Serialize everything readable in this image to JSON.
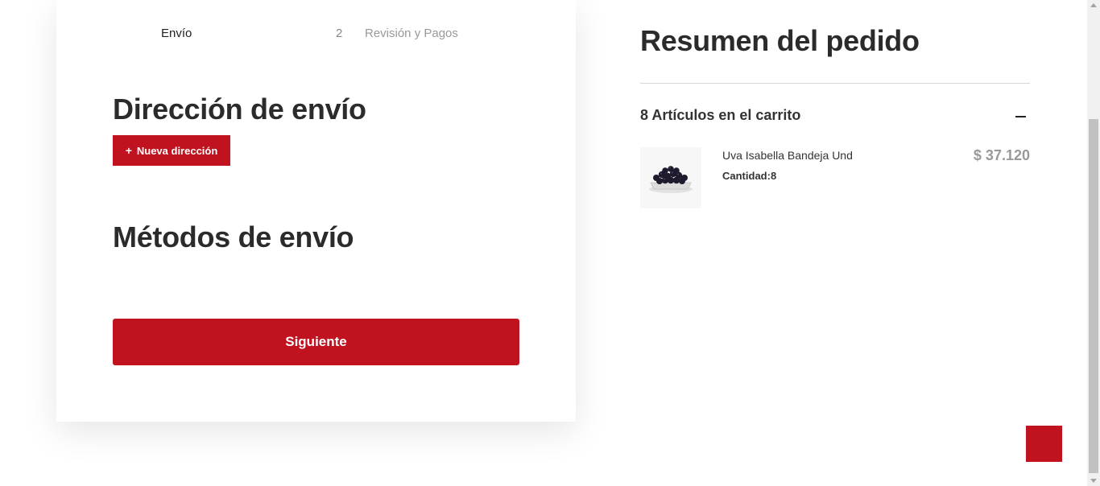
{
  "checkout": {
    "steps": [
      {
        "number": "",
        "label": "Envío",
        "active": true
      },
      {
        "number": "2",
        "label": "Revisión y Pagos",
        "active": false
      }
    ],
    "shipping_address": {
      "title": "Dirección de envío",
      "new_address_icon": "+",
      "new_address_label": "Nueva dirección"
    },
    "shipping_methods": {
      "title": "Métodos de envío"
    },
    "next_button_label": "Siguiente"
  },
  "summary": {
    "title": "Resumen del pedido",
    "cart_count_label": "8 Artículos en el carrito",
    "collapse_icon": "minus-icon",
    "items": [
      {
        "name": "Uva Isabella Bandeja Und",
        "quantity_label": "Cantidad:",
        "quantity": "8",
        "price": "$ 37.120",
        "image_icon": "grapes-tray-image"
      }
    ]
  },
  "colors": {
    "accent": "#c1121f",
    "text_dark": "#2b2b2b",
    "text_muted": "#999999"
  }
}
